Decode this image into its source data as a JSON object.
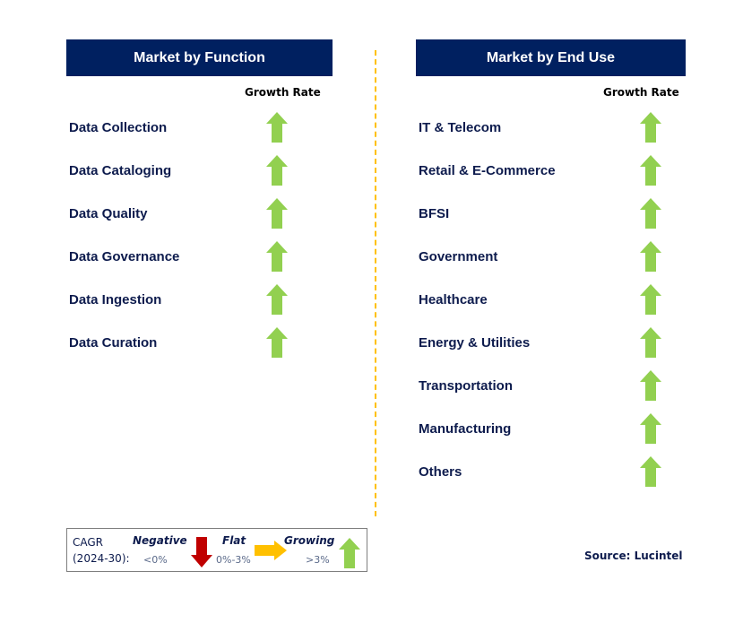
{
  "left_panel": {
    "title": "Market by Function",
    "growth_rate_label": "Growth Rate",
    "items": [
      {
        "label": "Data Collection",
        "trend": "growing"
      },
      {
        "label": "Data Cataloging",
        "trend": "growing"
      },
      {
        "label": "Data Quality",
        "trend": "growing"
      },
      {
        "label": "Data Governance",
        "trend": "growing"
      },
      {
        "label": "Data Ingestion",
        "trend": "growing"
      },
      {
        "label": "Data Curation",
        "trend": "growing"
      }
    ]
  },
  "right_panel": {
    "title": "Market by End Use",
    "growth_rate_label": "Growth Rate",
    "items": [
      {
        "label": "IT & Telecom",
        "trend": "growing"
      },
      {
        "label": "Retail & E-Commerce",
        "trend": "growing"
      },
      {
        "label": "BFSI",
        "trend": "growing"
      },
      {
        "label": "Government",
        "trend": "growing"
      },
      {
        "label": "Healthcare",
        "trend": "growing"
      },
      {
        "label": "Energy & Utilities",
        "trend": "growing"
      },
      {
        "label": "Transportation",
        "trend": "growing"
      },
      {
        "label": "Manufacturing",
        "trend": "growing"
      },
      {
        "label": "Others",
        "trend": "growing"
      }
    ]
  },
  "legend": {
    "cagr_line1": "CAGR",
    "cagr_line2": "(2024-30):",
    "negative": {
      "label": "Negative",
      "range": "<0%",
      "icon": "down-arrow-icon",
      "color": "#c00000"
    },
    "flat": {
      "label": "Flat",
      "range": "0%-3%",
      "icon": "right-arrow-icon",
      "color": "#ffc000"
    },
    "growing": {
      "label": "Growing",
      "range": ">3%",
      "icon": "up-arrow-icon",
      "color": "#92d050"
    }
  },
  "source": "Source: Lucintel",
  "colors": {
    "header_bg": "#002060",
    "label_text": "#0d1b4d",
    "divider": "#ffc000",
    "growing": "#92d050"
  }
}
